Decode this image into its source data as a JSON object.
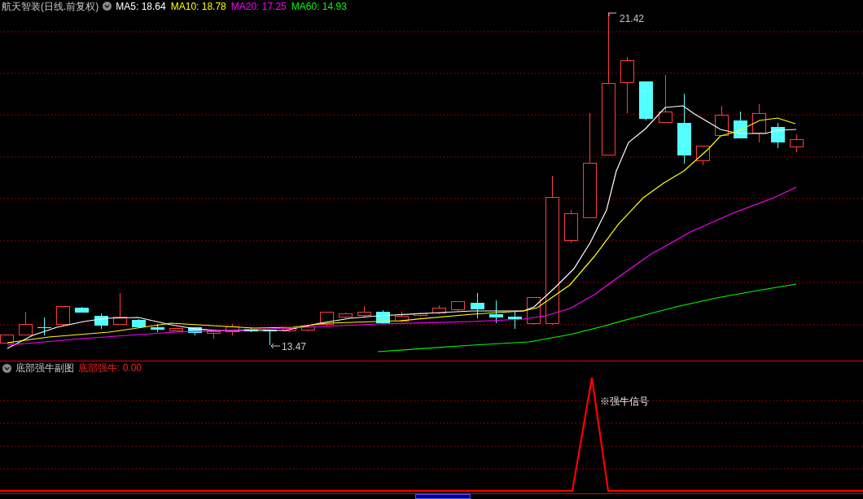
{
  "main_chart": {
    "title": "航天智装(日线.前复权)",
    "legend": [
      {
        "label": "MA5: 18.64",
        "color": "#ffffff"
      },
      {
        "label": "MA10: 18.78",
        "color": "#ffff00"
      },
      {
        "label": "MA20: 17.25",
        "color": "#ff00ff"
      },
      {
        "label": "MA60: 14.93",
        "color": "#00ff00"
      }
    ],
    "high_label": "21.42",
    "low_label": "13.47"
  },
  "sub_chart": {
    "title": "底部强牛副图",
    "value_label": "底部强牛: 0.00",
    "signal_label": "※强牛信号"
  }
}
